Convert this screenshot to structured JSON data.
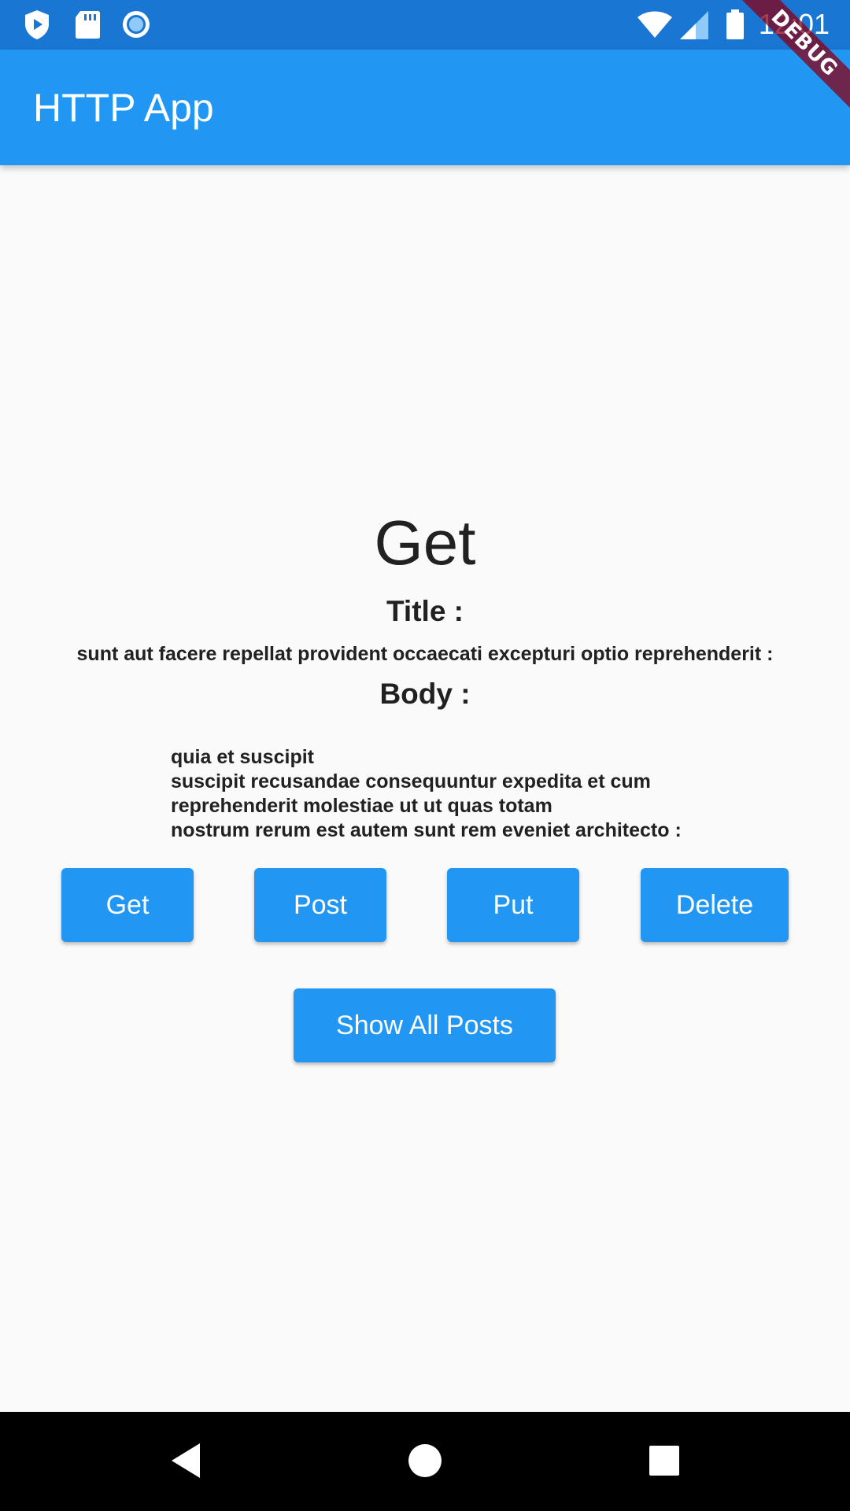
{
  "status_bar": {
    "time": "12:01",
    "icons": [
      "play-protect-icon",
      "sd-card-icon",
      "circle-record-icon",
      "wifi-icon",
      "signal-icon",
      "battery-icon"
    ]
  },
  "app_bar": {
    "title": "HTTP App"
  },
  "debug_banner": {
    "label": "DEBUG"
  },
  "main": {
    "heading": "Get",
    "title_label": "Title :",
    "title_value": "sunt aut facere repellat provident occaecati excepturi optio reprehenderit :",
    "body_label": "Body :",
    "body_lines": [
      "quia et suscipit",
      "suscipit recusandae consequuntur expedita et cum",
      "reprehenderit molestiae ut ut quas totam",
      "nostrum rerum est autem sunt rem eveniet architecto :"
    ]
  },
  "buttons": {
    "get": "Get",
    "post": "Post",
    "put": "Put",
    "delete": "Delete",
    "show_all": "Show All Posts"
  },
  "nav_bar": {
    "icons": [
      "back-icon",
      "home-icon",
      "recents-icon"
    ]
  },
  "colors": {
    "status_bar": "#1976d2",
    "app_bar": "#2196f3",
    "button": "#2196f3",
    "background": "#fafafa",
    "text": "#212121",
    "debug": "#880015"
  }
}
